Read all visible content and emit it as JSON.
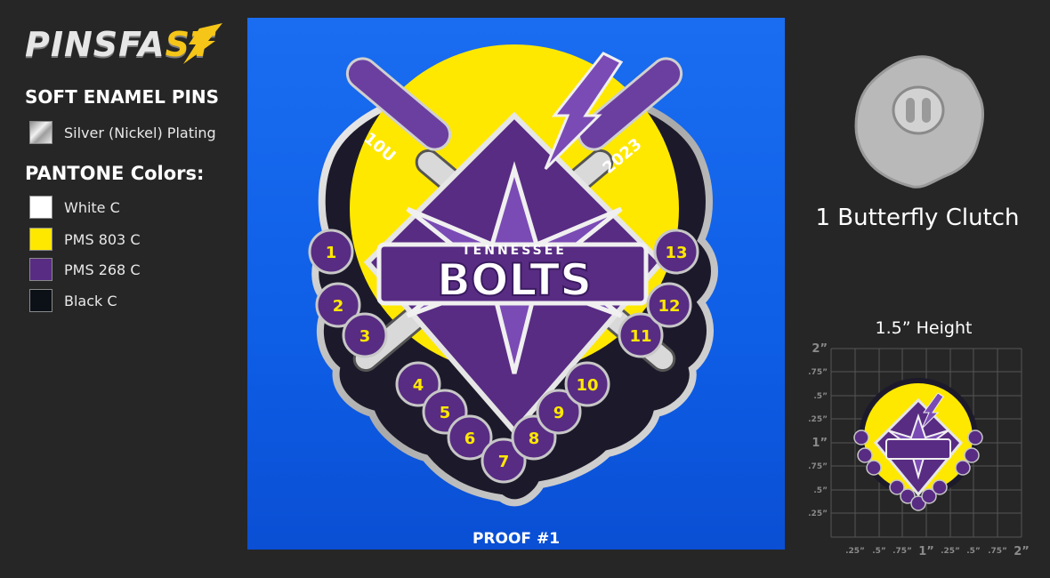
{
  "brand": {
    "logo_text_main": "PINSFA",
    "logo_text_accent": "ST"
  },
  "left_panel": {
    "product_heading": "SOFT ENAMEL PINS",
    "plating": {
      "label": "Silver (Nickel) Plating"
    },
    "pantone_heading": "PANTONE Colors:",
    "colors": [
      {
        "label": "White C",
        "hex": "#ffffff"
      },
      {
        "label": "PMS 803 C",
        "hex": "#ffe800"
      },
      {
        "label": "PMS 268 C",
        "hex": "#582c83"
      },
      {
        "label": "Black C",
        "hex": "#0c1118"
      }
    ]
  },
  "proof": {
    "label": "PROOF #1",
    "pin": {
      "top_text": "TENNESSEE",
      "main_text": "BOLTS",
      "left_bat_text": "10U",
      "right_bat_text": "2023",
      "numbers": [
        "1",
        "2",
        "3",
        "4",
        "5",
        "6",
        "7",
        "8",
        "9",
        "10",
        "11",
        "12",
        "13"
      ]
    }
  },
  "clutch": {
    "label": "1 Butterfly Clutch"
  },
  "size_guide": {
    "height_label": "1.5” Height",
    "y_ticks": [
      "2”",
      ".75”",
      ".5”",
      ".25”",
      "1”",
      ".75”",
      ".5”",
      ".25”"
    ],
    "x_ticks": [
      ".25”",
      ".5”",
      ".75”",
      "1”",
      ".25”",
      ".5”",
      ".75”",
      "2”"
    ]
  },
  "colors": {
    "yellow": "#ffe800",
    "purple": "#582c83",
    "blue_bg": "#1565ec",
    "background": "#262626"
  }
}
